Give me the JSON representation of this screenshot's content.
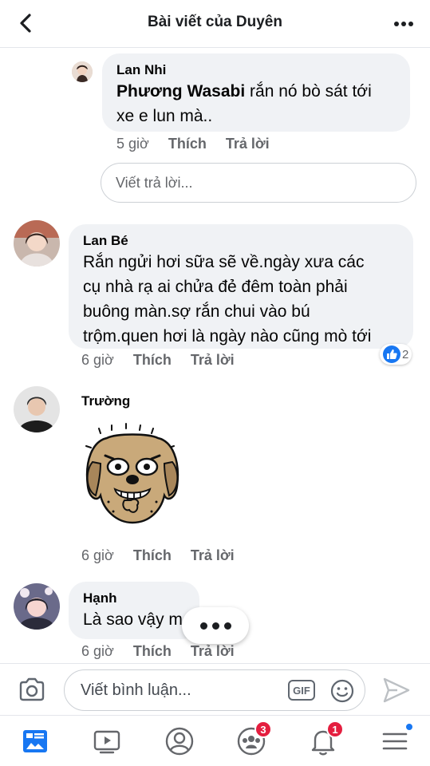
{
  "header": {
    "title": "Bài viết của Duyên"
  },
  "comments": [
    {
      "author": "Lan Nhi",
      "mention": "Phương Wasabi",
      "text_line1": " rắn nó bò sát tới",
      "text_line2": "xe e lun mà..",
      "time": "5 giờ",
      "like": "Thích",
      "reply": "Trả lời"
    },
    {
      "author": "Lan Bé",
      "text_lines": [
        "Rắn ngửi hơi sữa sẽ về.ngày xưa các",
        "cụ nhà rạ ai chửa đẻ đêm toàn phải",
        "buông màn.sợ rắn chui vào bú",
        "trộm.quen hơi là ngày nào cũng mò tới"
      ],
      "reaction_count": "2",
      "time": "6 giờ",
      "like": "Thích",
      "reply": "Trả lời"
    },
    {
      "author": "Trường",
      "time": "6 giờ",
      "like": "Thích",
      "reply": "Trả lời"
    },
    {
      "author": "Hạnh",
      "text": "Là sao vậy m",
      "time": "6 giờ",
      "like": "Thích",
      "reply": "Trả lời"
    }
  ],
  "reply_box": {
    "placeholder": "Viết trả lời..."
  },
  "composer": {
    "placeholder": "Viết bình luận...",
    "gif_label": "GIF"
  },
  "tabbar": {
    "groups_badge": "3",
    "notifications_badge": "1"
  },
  "colors": {
    "accent": "#1877f2",
    "badge": "#e41e3f",
    "bubble": "#f0f2f5"
  }
}
